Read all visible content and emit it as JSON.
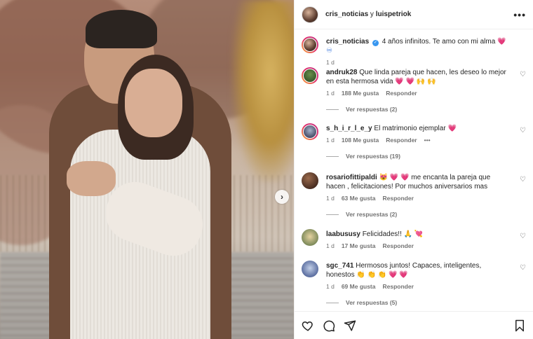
{
  "header": {
    "author": "cris_noticias",
    "joiner": " y ",
    "coauthor": "luispetriok",
    "more_label": "•••"
  },
  "caption": {
    "user": "cris_noticias",
    "text": "4 años infinitos. Te amo con mi alma",
    "emoji": "💗",
    "emoji2": "♾",
    "time": "1 d"
  },
  "comments": [
    {
      "user": "andruk28",
      "text": "Que linda pareja que hacen, les deseo lo mejor en esta hermosa vida",
      "emoji": "💗 💗 🙌 🙌",
      "time": "1 d",
      "likes": "188 Me gusta",
      "reply_label": "Responder",
      "view_replies": "Ver respuestas (2)"
    },
    {
      "user": "s_h_i_r_l_e_y",
      "text": "El matrimonio ejemplar",
      "emoji": "💗",
      "time": "1 d",
      "likes": "108 Me gusta",
      "reply_label": "Responder",
      "more_label": "•••",
      "view_replies": "Ver respuestas (19)"
    },
    {
      "user": "rosariofittipaldi",
      "pre_emoji": "😻 💗 💗",
      "text": "me encanta la pareja que hacen , felicitaciones! Por muchos aniversarios mas",
      "time": "1 d",
      "likes": "63 Me gusta",
      "reply_label": "Responder",
      "view_replies": "Ver respuestas (2)"
    },
    {
      "user": "laabususy",
      "text": "Felicidades!!",
      "emoji": "🙏 💘",
      "time": "1 d",
      "likes": "17 Me gusta",
      "reply_label": "Responder"
    },
    {
      "user": "sgc_741",
      "text": "Hermosos juntos! Capaces, inteligentes, honestos",
      "emoji": "👏 👏 👏 💗 💗",
      "time": "1 d",
      "likes": "69 Me gusta",
      "reply_label": "Responder",
      "view_replies": "Ver respuestas (5)"
    }
  ],
  "photo": {
    "next_label": "›"
  },
  "icons": {
    "like": "heart-icon",
    "comment": "comment-icon",
    "share": "share-icon",
    "save": "bookmark-icon",
    "verified": "verified-badge-icon"
  },
  "colors": {
    "heart": "#e0245e",
    "verified": "#3897f0",
    "muted": "#737373"
  }
}
